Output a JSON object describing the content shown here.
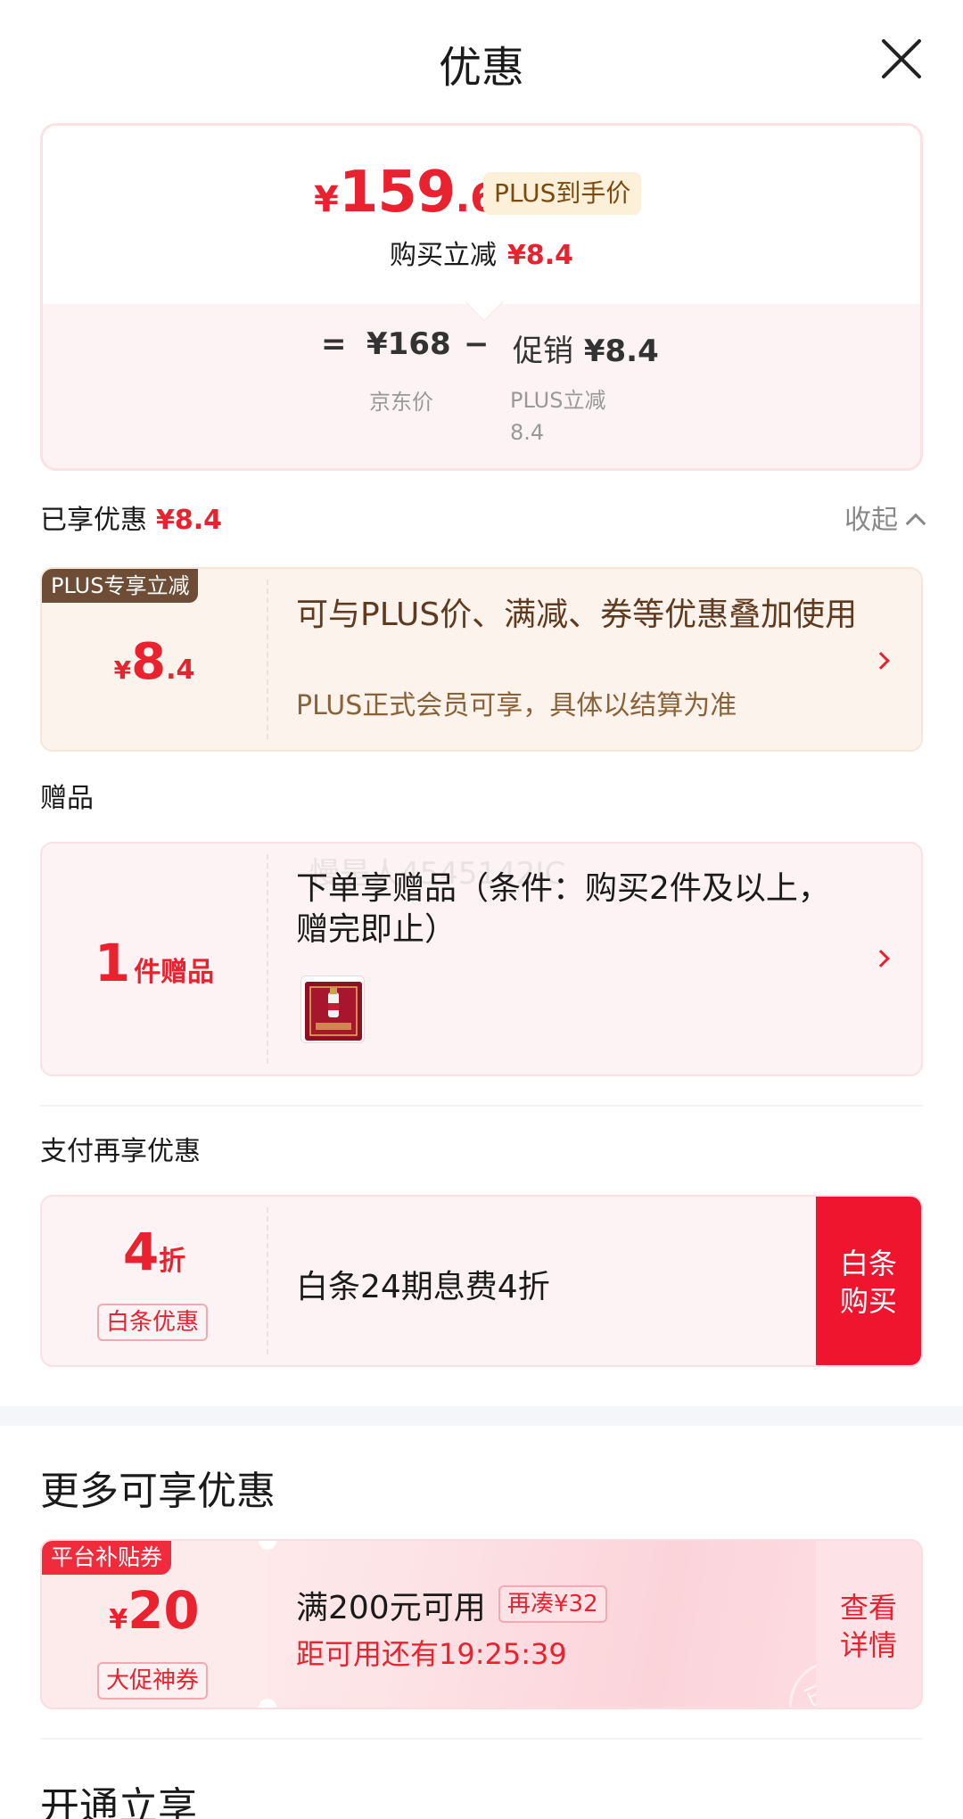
{
  "header": {
    "title": "优惠",
    "close_icon": "close-icon"
  },
  "price_summary": {
    "currency": "¥",
    "final_price_int": "159",
    "final_price_dec": ".6",
    "final_price_tag": "PLUS到手价",
    "reduce_label": "购买立减",
    "reduce_amount": "¥8.4",
    "equals": "=",
    "jd_price": "¥168",
    "jd_price_label": "京东价",
    "minus": "−",
    "promo_label": "促销",
    "promo_amount": "¥8.4",
    "promo_sub_label": "PLUS立减",
    "promo_sub_value": "8.4"
  },
  "enjoyed": {
    "label": "已享优惠",
    "amount": "¥8.4",
    "collapse_label": "收起"
  },
  "plus_coupon": {
    "badge": "PLUS专享立减",
    "currency": "¥",
    "amount_int": "8",
    "amount_dec": ".4",
    "main_text": "可与PLUS价、满减、券等优惠叠加使用",
    "sub_text": "PLUS正式会员可享，具体以结算为准"
  },
  "gift_section": {
    "label": "赠品"
  },
  "gift_coupon": {
    "count": "1",
    "unit": "件赠品",
    "main_text": "下单享赠品（条件：购买2件及以上，赠完即止）",
    "watermark": "慢是人4545142JC"
  },
  "pay_section": {
    "label": "支付再享优惠"
  },
  "baitiao_coupon": {
    "discount": "4",
    "unit": "折",
    "tag": "白条优惠",
    "main_text": "白条24期息费4折",
    "action_line1": "白条",
    "action_line2": "购买"
  },
  "more_section": {
    "title": "更多可享优惠"
  },
  "platform_coupon": {
    "badge": "平台补贴券",
    "currency": "¥",
    "amount": "20",
    "tag": "大促神券",
    "condition": "满200元可用",
    "extra_tag": "再凑¥32",
    "countdown": "距可用还有19:25:39",
    "action_line1": "查看",
    "action_line2": "详情",
    "stamp": "已领"
  },
  "open_section": {
    "title": "开通立享"
  },
  "colors": {
    "accent_red": "#e8222f",
    "plus_brown": "#6e4c35",
    "buy_red": "#f0152f"
  }
}
